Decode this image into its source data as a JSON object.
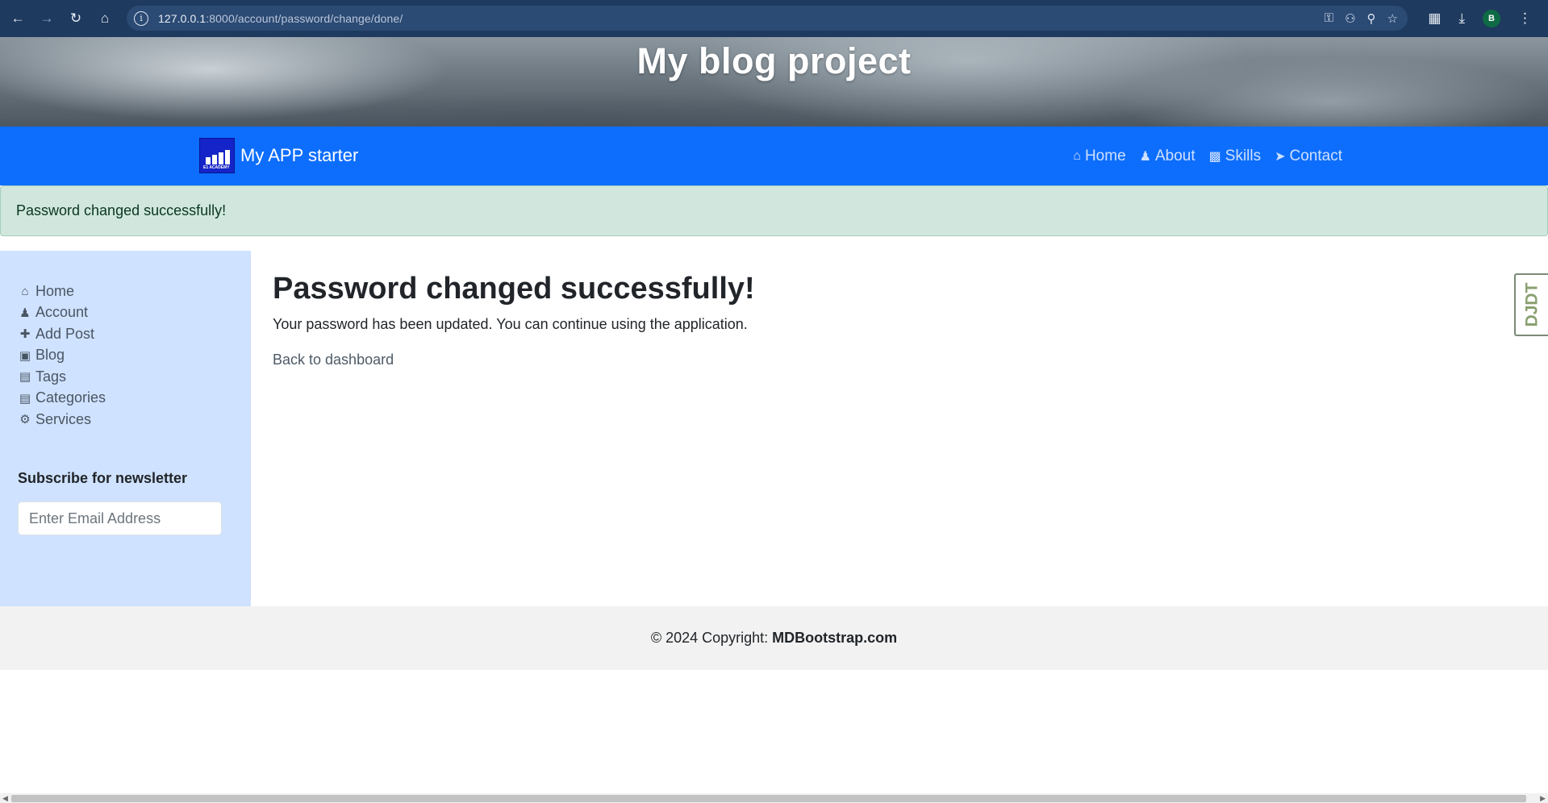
{
  "browser": {
    "url_host": "127.0.0.1",
    "url_rest": ":8000/account/password/change/done/",
    "profile_initial": "B"
  },
  "banner": {
    "title": "My blog project"
  },
  "navbar": {
    "brand_name": "My APP starter",
    "logo_text": "E1 ACADEMY",
    "links": [
      {
        "icon": "home-icon",
        "label": "Home"
      },
      {
        "icon": "user-icon",
        "label": "About"
      },
      {
        "icon": "book-icon",
        "label": "Skills"
      },
      {
        "icon": "paper-plane-icon",
        "label": "Contact"
      }
    ]
  },
  "alert": {
    "message": "Password changed successfully!"
  },
  "sidebar": {
    "items": [
      {
        "icon": "home-icon",
        "label": "Home"
      },
      {
        "icon": "user-icon",
        "label": "Account"
      },
      {
        "icon": "plus-icon",
        "label": "Add Post"
      },
      {
        "icon": "sticky-note-icon",
        "label": "Blog"
      },
      {
        "icon": "briefcase-icon",
        "label": "Tags"
      },
      {
        "icon": "briefcase-icon",
        "label": "Categories"
      },
      {
        "icon": "gears-icon",
        "label": "Services"
      }
    ],
    "newsletter_title": "Subscribe for newsletter",
    "email_placeholder": "Enter Email Address"
  },
  "main": {
    "heading": "Password changed successfully!",
    "body": "Your password has been updated. You can continue using the application.",
    "link": "Back to dashboard"
  },
  "djdt": {
    "label": "DJDT"
  },
  "footer": {
    "prefix": "© 2024 Copyright:",
    "site": "MDBootstrap.com"
  },
  "colors": {
    "navbar": "#0d6efd",
    "alert_bg": "#d1e7dd",
    "sidebar_bg": "#cfe2ff",
    "footer_bg": "#f2f2f2"
  }
}
